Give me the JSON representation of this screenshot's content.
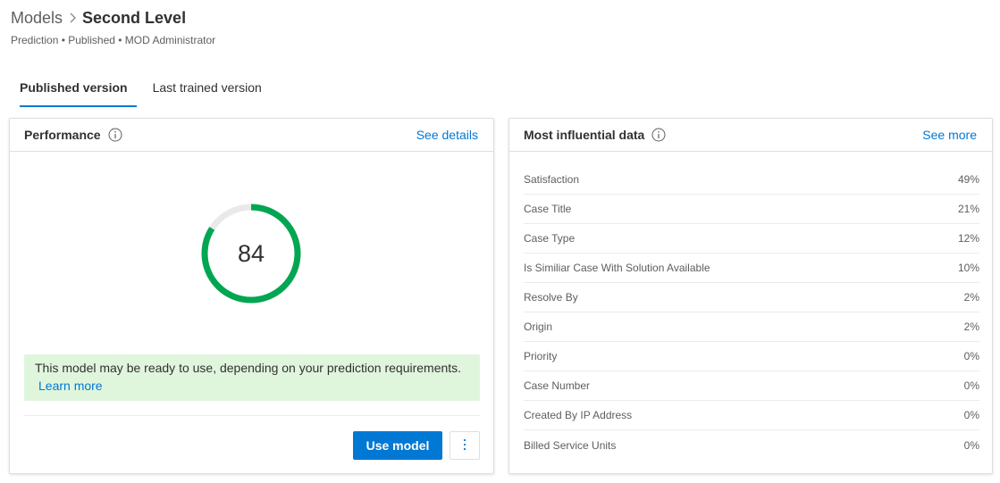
{
  "breadcrumb": {
    "root": "Models",
    "current": "Second Level"
  },
  "subtitle": "Prediction • Published • MOD Administrator",
  "tabs": [
    {
      "label": "Published version",
      "active": true
    },
    {
      "label": "Last trained version",
      "active": false
    }
  ],
  "performance": {
    "title": "Performance",
    "link": "See details",
    "score": "84",
    "score_fraction": 0.84,
    "notice": "This model may be ready to use, depending on your prediction requirements.",
    "learn_more": "Learn more",
    "use_model": "Use model"
  },
  "influential": {
    "title": "Most influential data",
    "link": "See more",
    "items": [
      {
        "label": "Satisfaction",
        "pct": "49%"
      },
      {
        "label": "Case Title",
        "pct": "21%"
      },
      {
        "label": "Case Type",
        "pct": "12%"
      },
      {
        "label": "Is Similiar Case With Solution Available",
        "pct": "10%"
      },
      {
        "label": "Resolve By",
        "pct": "2%"
      },
      {
        "label": "Origin",
        "pct": "2%"
      },
      {
        "label": "Priority",
        "pct": "0%"
      },
      {
        "label": "Case Number",
        "pct": "0%"
      },
      {
        "label": "Created By IP Address",
        "pct": "0%"
      },
      {
        "label": "Billed Service Units",
        "pct": "0%"
      }
    ]
  },
  "colors": {
    "accent": "#0078d4",
    "gauge_fill": "#00a651",
    "gauge_track": "#e9e9e9",
    "notice_bg": "#dff6dd"
  },
  "icons": [
    "chevron-right-icon",
    "info-icon",
    "more-vertical-icon"
  ]
}
